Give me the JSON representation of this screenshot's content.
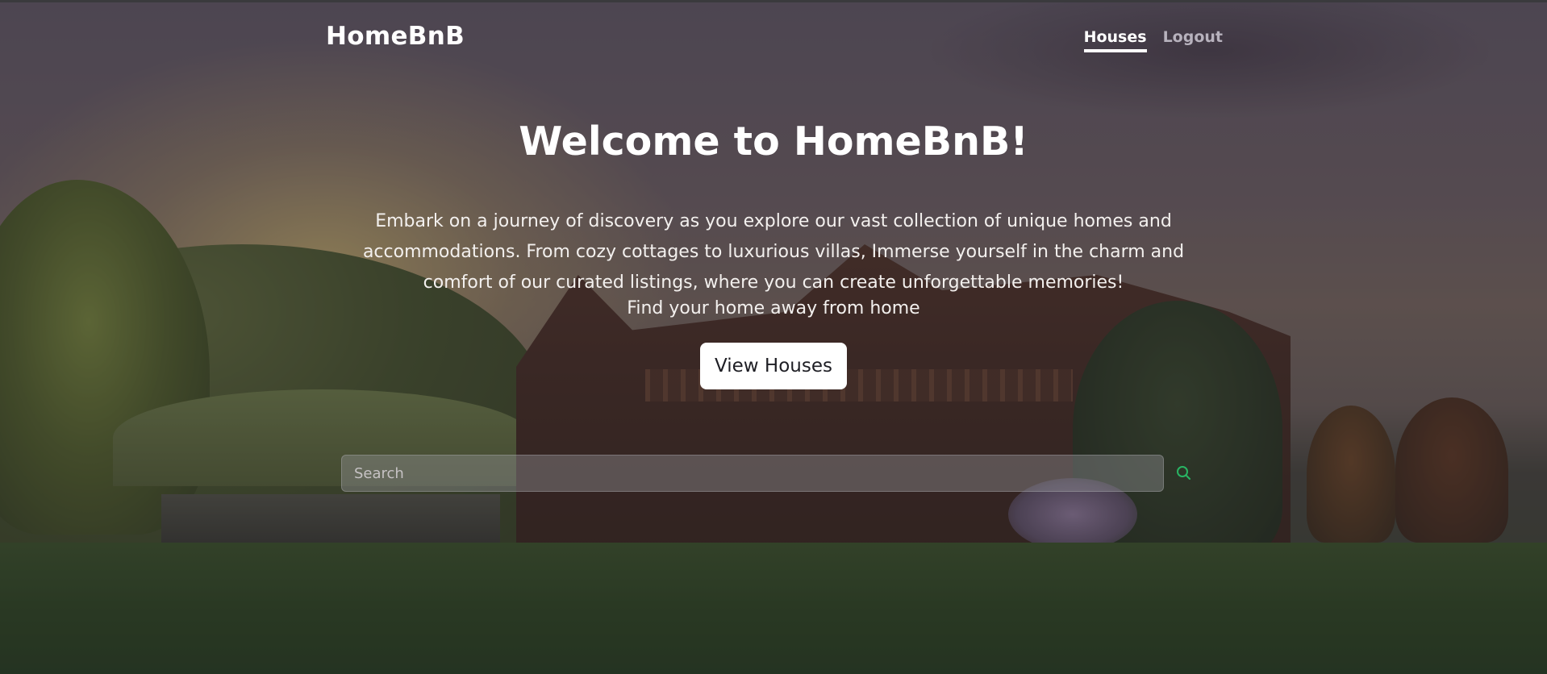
{
  "navbar": {
    "brand": "HomeBnB",
    "links": [
      {
        "label": "Houses",
        "active": true
      },
      {
        "label": "Logout",
        "active": false
      }
    ]
  },
  "hero": {
    "title": "Welcome to HomeBnB!",
    "description": "Embark on a journey of discovery as you explore our vast collection of unique homes and accommodations. From cozy cottages to luxurious villas, Immerse yourself in the charm and comfort of our curated listings, where you can create unforgettable memories!",
    "subline": "Find your home away from home",
    "cta_label": "View Houses"
  },
  "search": {
    "placeholder": "Search",
    "value": "",
    "icon": "search-icon",
    "icon_color": "#28b463"
  },
  "colors": {
    "overlay": "rgba(35,35,45,0.45)",
    "button_bg": "#ffffff",
    "button_text": "#1e1e24",
    "nav_muted": "#b7b2bd"
  }
}
